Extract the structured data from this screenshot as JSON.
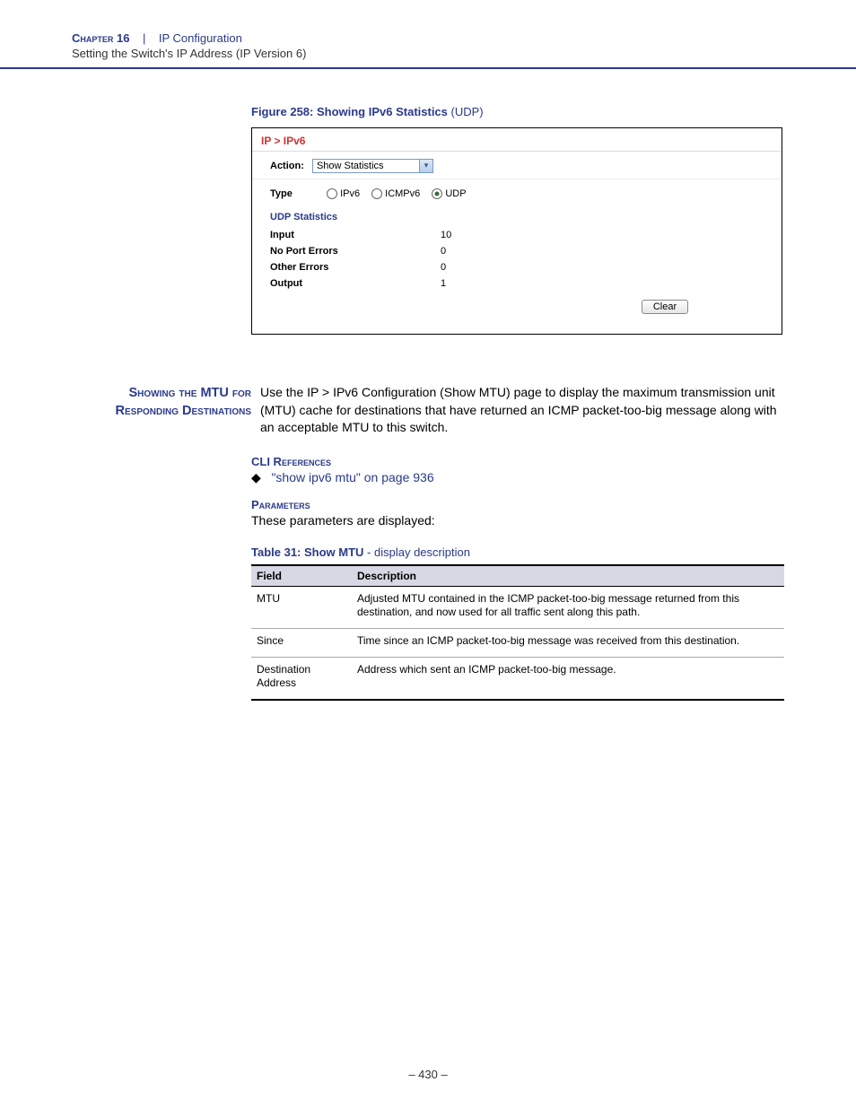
{
  "header": {
    "chapter": "Chapter 16",
    "separator": "|",
    "title": "IP Configuration",
    "subtitle": "Setting the Switch's IP Address (IP Version 6)"
  },
  "figure": {
    "label": "Figure 258:  Showing IPv6 Statistics",
    "suffix": " (UDP)"
  },
  "screenshot": {
    "breadcrumb": "IP > IPv6",
    "action_label": "Action:",
    "action_value": "Show Statistics",
    "type_label": "Type",
    "radios": {
      "ipv6": "IPv6",
      "icmpv6": "ICMPv6",
      "udp": "UDP"
    },
    "section_title": "UDP Statistics",
    "rows": [
      {
        "field": "Input",
        "value": "10"
      },
      {
        "field": "No Port Errors",
        "value": "0"
      },
      {
        "field": "Other Errors",
        "value": "0"
      },
      {
        "field": "Output",
        "value": "1"
      }
    ],
    "clear_btn": "Clear"
  },
  "section": {
    "heading": "Showing the MTU for Responding Destinations",
    "body": "Use the IP > IPv6 Configuration (Show MTU) page to display the maximum transmission unit (MTU) cache for destinations that have returned an ICMP packet-too-big message along with an acceptable MTU to this switch."
  },
  "cli": {
    "heading": "CLI References",
    "link": "\"show ipv6 mtu\" on page 936"
  },
  "params": {
    "heading": "Parameters",
    "intro": "These parameters are displayed:"
  },
  "table": {
    "caption_bold": "Table 31: Show MTU",
    "caption_rest": " - display description",
    "headers": {
      "field": "Field",
      "desc": "Description"
    },
    "rows": [
      {
        "field": "MTU",
        "desc": "Adjusted MTU contained in the ICMP packet-too-big message returned from this destination, and now used for all traffic sent along this path."
      },
      {
        "field": "Since",
        "desc": "Time since an ICMP packet-too-big message was received from this destination."
      },
      {
        "field": "Destination Address",
        "desc": "Address which sent an ICMP packet-too-big message."
      }
    ]
  },
  "page_number": "–  430  –"
}
